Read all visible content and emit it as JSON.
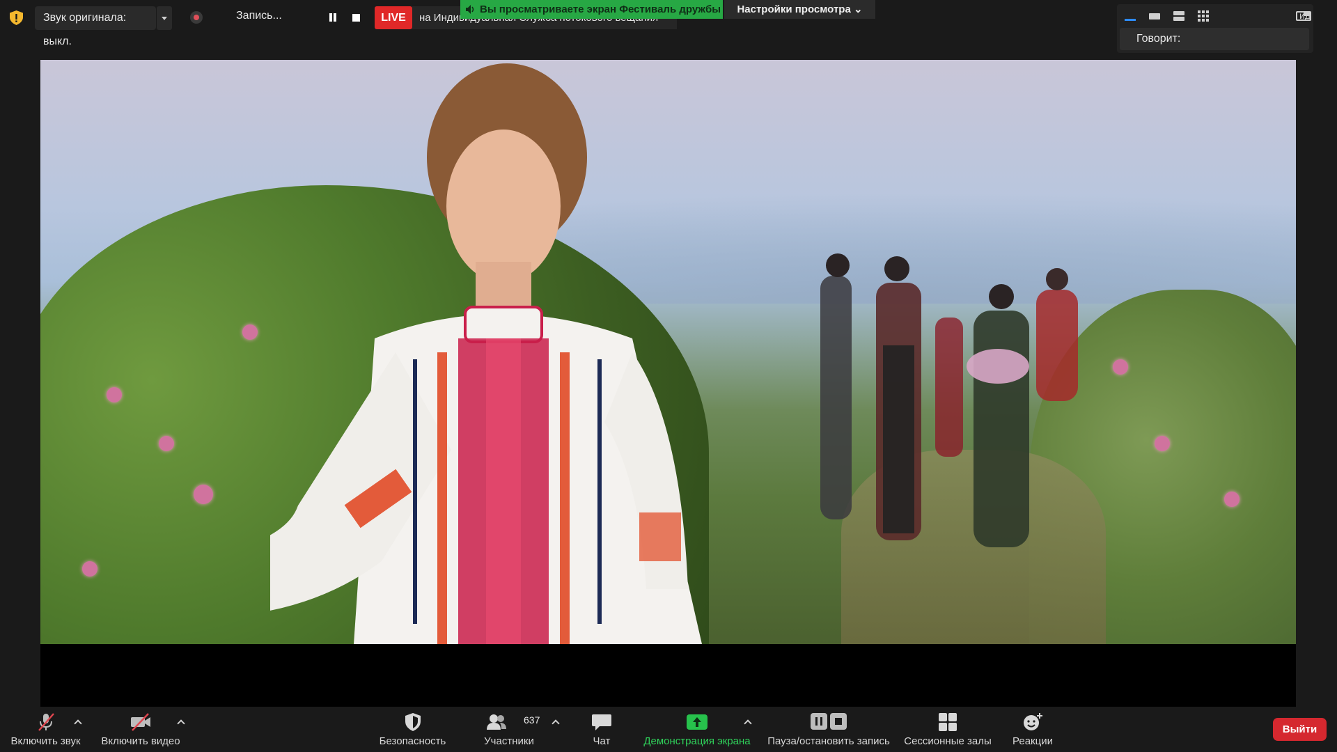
{
  "top_bar": {
    "audio_label": "Звук оригинала: выкл.",
    "recording_label": "Запись...",
    "live_badge": "LIVE",
    "live_destination": "на Индивидуальная Служба потокового вещания"
  },
  "share_banner": {
    "text": "Вы просматриваете экран Фестиваль дружбы",
    "view_settings": "Настройки просмотра ⌄"
  },
  "view_switcher": {
    "speaking_label": "Говорит:",
    "side_label": "ид"
  },
  "toolbar": {
    "unmute": "Включить звук",
    "start_video": "Включить видео",
    "security": "Безопасность",
    "participants": "Участники",
    "participants_count": "637",
    "chat": "Чат",
    "share_screen": "Демонстрация экрана",
    "pause_stop_recording": "Пауза/остановить запись",
    "breakout_rooms": "Сессионные залы",
    "reactions": "Реакции",
    "leave": "Выйти"
  },
  "colors": {
    "live_red": "#e02828",
    "share_green": "#27a844",
    "leave_red": "#d5282f",
    "security_yellow": "#f5b82e"
  },
  "icons": [
    "shield-warning-icon",
    "record-icon",
    "pause-icon",
    "stop-icon",
    "speaker-icon",
    "mic-off-icon",
    "video-off-icon",
    "security-shield-icon",
    "participants-icon",
    "chat-icon",
    "share-screen-icon",
    "pause-record-icon",
    "breakout-rooms-icon",
    "reactions-icon"
  ]
}
